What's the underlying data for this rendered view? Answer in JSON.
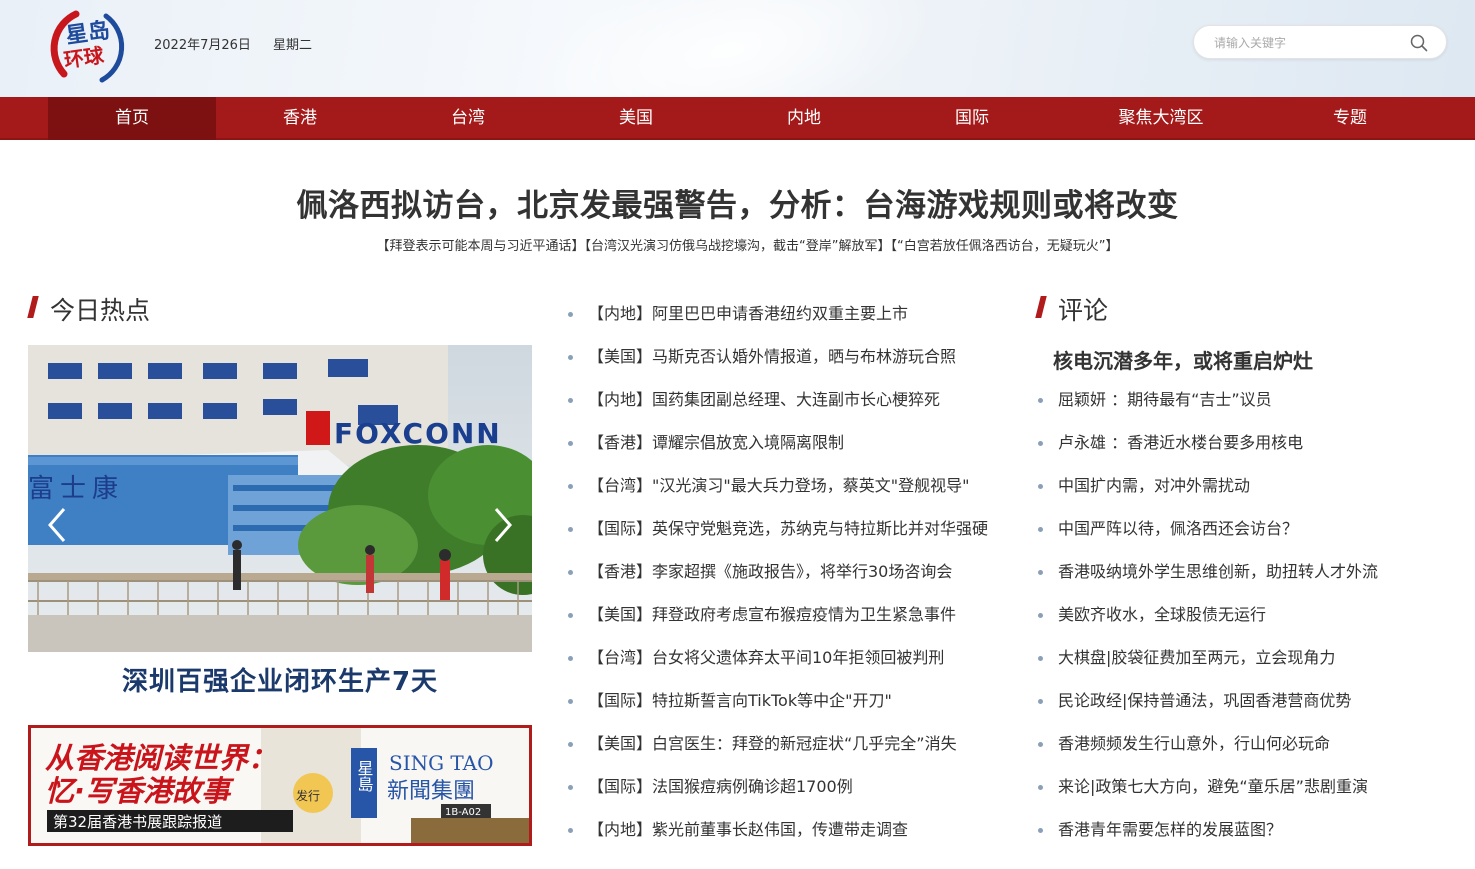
{
  "header": {
    "logo_text": [
      "星岛",
      "环球"
    ],
    "date": "2022年7月26日",
    "weekday": "星期二",
    "search_placeholder": "请输入关键字"
  },
  "nav": {
    "items": [
      "首页",
      "香港",
      "台湾",
      "美国",
      "内地",
      "国际",
      "聚焦大湾区",
      "专题"
    ],
    "active_index": 0
  },
  "headline": {
    "title": "佩洛西拟访台，北京发最强警告，分析：台海游戏规则或将改变",
    "sublinks": [
      "【拜登表示可能本周与习近平通话】",
      "【台湾汉光演习仿俄乌战挖壕沟，截击“登岸”解放军】",
      "【“白宫若放任佩洛西访台，无疑玩火”】"
    ]
  },
  "hot": {
    "title": "今日热点",
    "slide_caption": "深圳百强企业闭环生产7天",
    "slide_sign_cn": "富士康",
    "slide_sign_en": "FOXCONN",
    "banner": {
      "line1": "从香港阅读世界：",
      "line2": "忆·写香港故事",
      "tag": "第32届香港书展跟踪报道",
      "brand_en": "SING TAO",
      "brand_cn": "新聞集團",
      "brand_side": "星島",
      "booth": "1B-A02",
      "issue": "发行"
    }
  },
  "news": [
    "【内地】阿里巴巴申请香港纽约双重主要上市",
    "【美国】马斯克否认婚外情报道，晒与布林游玩合照",
    "【内地】国药集团副总经理、大连副市长心梗猝死",
    "【香港】谭耀宗倡放宽入境隔离限制",
    "【台湾】\"汉光演习\"最大兵力登场，蔡英文\"登舰视导\"",
    "【国际】英保守党魁竞选，苏纳克与特拉斯比并对华强硬",
    "【香港】李家超撰《施政报告》，将举行30场咨询会",
    "【美国】拜登政府考虑宣布猴痘疫情为卫生紧急事件",
    "【台湾】台女将父遗体弃太平间10年拒领回被判刑",
    "【国际】特拉斯誓言向TikTok等中企\"开刀\"",
    "【美国】白宫医生：拜登的新冠症状“几乎完全”消失",
    "【国际】法国猴痘病例确诊超1700例",
    "【内地】紫光前董事长赵伟国，传遭带走调查"
  ],
  "comment": {
    "title": "评论",
    "lead": "核电沉潜多年，或将重启炉灶",
    "items": [
      "屈颖妍 ：期待最有“吉士”议员",
      "卢永雄 ：香港近水楼台要多用核电",
      "中国扩内需，对冲外需扰动",
      "中国严阵以待，佩洛西还会访台？",
      "香港吸纳境外学生思维创新，助扭转人才外流",
      "美欧齐收水，全球股债无运行",
      "大棋盘|胶袋征费加至两元，立会现角力",
      "民论政经|保持普通法，巩固香港营商优势",
      "香港频频发生行山意外，行山何必玩命",
      "来论|政策七大方向，避免“童乐居”悲剧重演",
      "香港青年需要怎样的发展蓝图？"
    ]
  },
  "colors": {
    "brand_red": "#a41a1a",
    "nav_active": "#7d1010",
    "caption_blue": "#1b3a6b"
  }
}
